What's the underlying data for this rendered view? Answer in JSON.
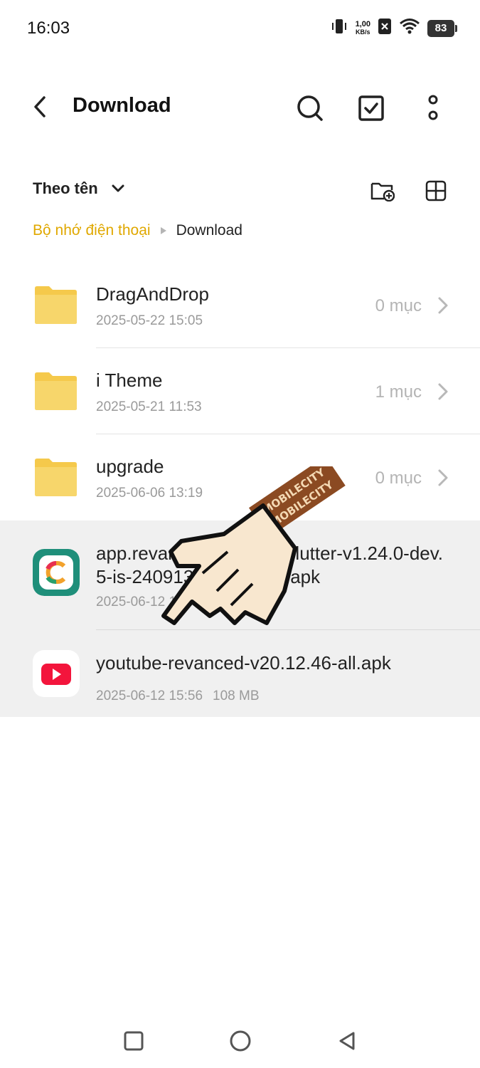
{
  "status_bar": {
    "time": "16:03",
    "speed_value": "1,00",
    "speed_unit": "KB/s",
    "battery": "83"
  },
  "header": {
    "title": "Download"
  },
  "sort": {
    "label": "Theo tên"
  },
  "breadcrumb": {
    "root": "Bộ nhớ điện thoại",
    "current": "Download"
  },
  "folders": [
    {
      "name": "DragAndDrop",
      "date": "2025-05-22 15:05",
      "count": "0 mục"
    },
    {
      "name": "i Theme",
      "date": "2025-05-21 11:53",
      "count": "1 mục"
    },
    {
      "name": "upgrade",
      "date": "2025-06-06 13:19",
      "count": "0 mục"
    }
  ],
  "files": [
    {
      "name": "app.revanced.manager.flutter-v1.24.0-dev.5-is-240913008-signed.apk",
      "date": "2025-06-12 1",
      "icon": "revanced-app-icon"
    },
    {
      "name": "youtube-revanced-v20.12.46-all.apk",
      "date": "2025-06-12 15:56",
      "size": "108 MB",
      "icon": "youtube-icon"
    }
  ],
  "overlay": {
    "watermark": "MOBILECITY"
  },
  "colors": {
    "accent": "#e0a800",
    "folder": "#f7d66b",
    "selected_row": "#f0f0f0",
    "revanced_bg": "#1f8f7a",
    "youtube_red": "#f3153c"
  }
}
